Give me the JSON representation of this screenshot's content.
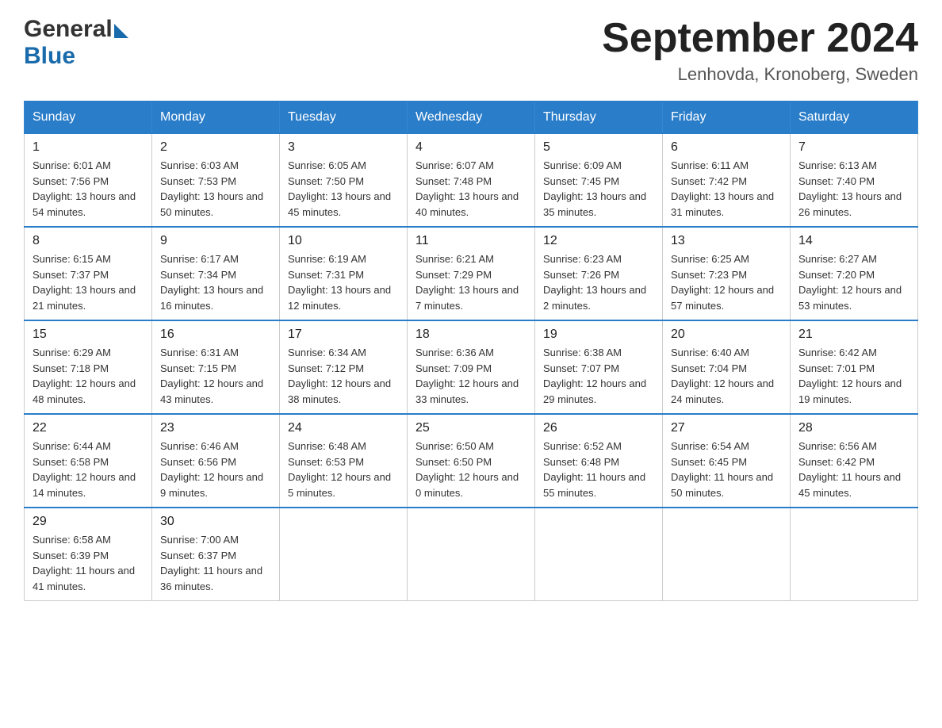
{
  "header": {
    "logo": {
      "general": "General",
      "blue": "Blue",
      "arrow": "▶"
    },
    "title": "September 2024",
    "location": "Lenhovda, Kronoberg, Sweden"
  },
  "calendar": {
    "headers": [
      "Sunday",
      "Monday",
      "Tuesday",
      "Wednesday",
      "Thursday",
      "Friday",
      "Saturday"
    ],
    "weeks": [
      [
        {
          "day": "1",
          "sunrise": "Sunrise: 6:01 AM",
          "sunset": "Sunset: 7:56 PM",
          "daylight": "Daylight: 13 hours and 54 minutes."
        },
        {
          "day": "2",
          "sunrise": "Sunrise: 6:03 AM",
          "sunset": "Sunset: 7:53 PM",
          "daylight": "Daylight: 13 hours and 50 minutes."
        },
        {
          "day": "3",
          "sunrise": "Sunrise: 6:05 AM",
          "sunset": "Sunset: 7:50 PM",
          "daylight": "Daylight: 13 hours and 45 minutes."
        },
        {
          "day": "4",
          "sunrise": "Sunrise: 6:07 AM",
          "sunset": "Sunset: 7:48 PM",
          "daylight": "Daylight: 13 hours and 40 minutes."
        },
        {
          "day": "5",
          "sunrise": "Sunrise: 6:09 AM",
          "sunset": "Sunset: 7:45 PM",
          "daylight": "Daylight: 13 hours and 35 minutes."
        },
        {
          "day": "6",
          "sunrise": "Sunrise: 6:11 AM",
          "sunset": "Sunset: 7:42 PM",
          "daylight": "Daylight: 13 hours and 31 minutes."
        },
        {
          "day": "7",
          "sunrise": "Sunrise: 6:13 AM",
          "sunset": "Sunset: 7:40 PM",
          "daylight": "Daylight: 13 hours and 26 minutes."
        }
      ],
      [
        {
          "day": "8",
          "sunrise": "Sunrise: 6:15 AM",
          "sunset": "Sunset: 7:37 PM",
          "daylight": "Daylight: 13 hours and 21 minutes."
        },
        {
          "day": "9",
          "sunrise": "Sunrise: 6:17 AM",
          "sunset": "Sunset: 7:34 PM",
          "daylight": "Daylight: 13 hours and 16 minutes."
        },
        {
          "day": "10",
          "sunrise": "Sunrise: 6:19 AM",
          "sunset": "Sunset: 7:31 PM",
          "daylight": "Daylight: 13 hours and 12 minutes."
        },
        {
          "day": "11",
          "sunrise": "Sunrise: 6:21 AM",
          "sunset": "Sunset: 7:29 PM",
          "daylight": "Daylight: 13 hours and 7 minutes."
        },
        {
          "day": "12",
          "sunrise": "Sunrise: 6:23 AM",
          "sunset": "Sunset: 7:26 PM",
          "daylight": "Daylight: 13 hours and 2 minutes."
        },
        {
          "day": "13",
          "sunrise": "Sunrise: 6:25 AM",
          "sunset": "Sunset: 7:23 PM",
          "daylight": "Daylight: 12 hours and 57 minutes."
        },
        {
          "day": "14",
          "sunrise": "Sunrise: 6:27 AM",
          "sunset": "Sunset: 7:20 PM",
          "daylight": "Daylight: 12 hours and 53 minutes."
        }
      ],
      [
        {
          "day": "15",
          "sunrise": "Sunrise: 6:29 AM",
          "sunset": "Sunset: 7:18 PM",
          "daylight": "Daylight: 12 hours and 48 minutes."
        },
        {
          "day": "16",
          "sunrise": "Sunrise: 6:31 AM",
          "sunset": "Sunset: 7:15 PM",
          "daylight": "Daylight: 12 hours and 43 minutes."
        },
        {
          "day": "17",
          "sunrise": "Sunrise: 6:34 AM",
          "sunset": "Sunset: 7:12 PM",
          "daylight": "Daylight: 12 hours and 38 minutes."
        },
        {
          "day": "18",
          "sunrise": "Sunrise: 6:36 AM",
          "sunset": "Sunset: 7:09 PM",
          "daylight": "Daylight: 12 hours and 33 minutes."
        },
        {
          "day": "19",
          "sunrise": "Sunrise: 6:38 AM",
          "sunset": "Sunset: 7:07 PM",
          "daylight": "Daylight: 12 hours and 29 minutes."
        },
        {
          "day": "20",
          "sunrise": "Sunrise: 6:40 AM",
          "sunset": "Sunset: 7:04 PM",
          "daylight": "Daylight: 12 hours and 24 minutes."
        },
        {
          "day": "21",
          "sunrise": "Sunrise: 6:42 AM",
          "sunset": "Sunset: 7:01 PM",
          "daylight": "Daylight: 12 hours and 19 minutes."
        }
      ],
      [
        {
          "day": "22",
          "sunrise": "Sunrise: 6:44 AM",
          "sunset": "Sunset: 6:58 PM",
          "daylight": "Daylight: 12 hours and 14 minutes."
        },
        {
          "day": "23",
          "sunrise": "Sunrise: 6:46 AM",
          "sunset": "Sunset: 6:56 PM",
          "daylight": "Daylight: 12 hours and 9 minutes."
        },
        {
          "day": "24",
          "sunrise": "Sunrise: 6:48 AM",
          "sunset": "Sunset: 6:53 PM",
          "daylight": "Daylight: 12 hours and 5 minutes."
        },
        {
          "day": "25",
          "sunrise": "Sunrise: 6:50 AM",
          "sunset": "Sunset: 6:50 PM",
          "daylight": "Daylight: 12 hours and 0 minutes."
        },
        {
          "day": "26",
          "sunrise": "Sunrise: 6:52 AM",
          "sunset": "Sunset: 6:48 PM",
          "daylight": "Daylight: 11 hours and 55 minutes."
        },
        {
          "day": "27",
          "sunrise": "Sunrise: 6:54 AM",
          "sunset": "Sunset: 6:45 PM",
          "daylight": "Daylight: 11 hours and 50 minutes."
        },
        {
          "day": "28",
          "sunrise": "Sunrise: 6:56 AM",
          "sunset": "Sunset: 6:42 PM",
          "daylight": "Daylight: 11 hours and 45 minutes."
        }
      ],
      [
        {
          "day": "29",
          "sunrise": "Sunrise: 6:58 AM",
          "sunset": "Sunset: 6:39 PM",
          "daylight": "Daylight: 11 hours and 41 minutes."
        },
        {
          "day": "30",
          "sunrise": "Sunrise: 7:00 AM",
          "sunset": "Sunset: 6:37 PM",
          "daylight": "Daylight: 11 hours and 36 minutes."
        },
        {
          "day": "",
          "sunrise": "",
          "sunset": "",
          "daylight": ""
        },
        {
          "day": "",
          "sunrise": "",
          "sunset": "",
          "daylight": ""
        },
        {
          "day": "",
          "sunrise": "",
          "sunset": "",
          "daylight": ""
        },
        {
          "day": "",
          "sunrise": "",
          "sunset": "",
          "daylight": ""
        },
        {
          "day": "",
          "sunrise": "",
          "sunset": "",
          "daylight": ""
        }
      ]
    ]
  }
}
